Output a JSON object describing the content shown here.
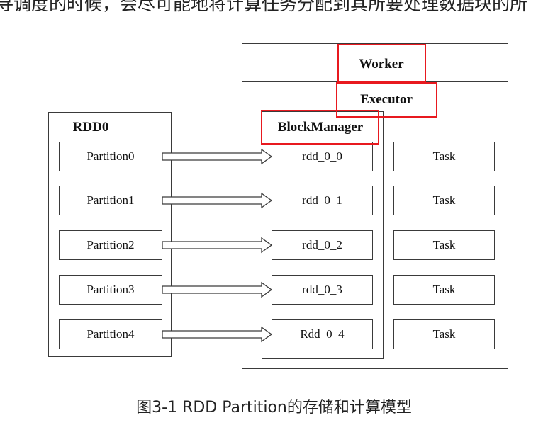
{
  "top_text": "寻调度的时候，会尽可能地将计算任务分配到其所要处理数据块的所",
  "worker": {
    "label": "Worker"
  },
  "executor": {
    "label": "Executor"
  },
  "block_manager": {
    "label": "BlockManager"
  },
  "rdd": {
    "label": "RDD0",
    "partitions": [
      "Partition0",
      "Partition1",
      "Partition2",
      "Partition3",
      "Partition4"
    ]
  },
  "blocks": [
    "rdd_0_0",
    "rdd_0_1",
    "rdd_0_2",
    "rdd_0_3",
    "Rdd_0_4"
  ],
  "tasks": [
    "Task",
    "Task",
    "Task",
    "Task",
    "Task"
  ],
  "caption": "图3-1 RDD Partition的存储和计算模型",
  "colors": {
    "highlight": "#e8191f",
    "border": "#3a3a3a"
  }
}
